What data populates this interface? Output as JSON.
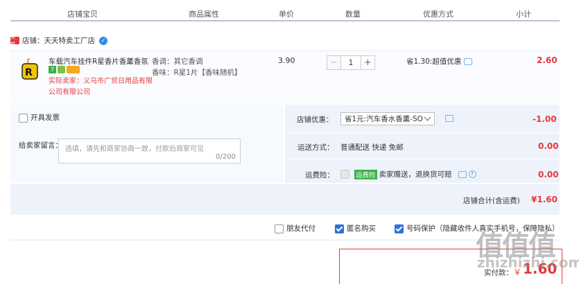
{
  "columns": [
    "店铺宝贝",
    "商品属性",
    "单价",
    "数量",
    "优惠方式",
    "小计"
  ],
  "shop": {
    "badge": "天猫",
    "name": "店铺：天天特卖工厂店"
  },
  "item": {
    "title": "车载汽车挂件R星香片香薰香氛...",
    "badge_num": "7",
    "seller": "实际卖家：义乌市广贸日用品有限公司有限公司",
    "attr1": "香调：其它香调",
    "attr2": "香味：R星1片【香味随机】",
    "price": "3.90",
    "qty": "1",
    "qty_minus": "−",
    "qty_plus": "+",
    "promo": "省1.30:超值优惠",
    "subtotal": "2.60"
  },
  "invoice_label": "开具发票",
  "message": {
    "label": "给卖家留言：",
    "placeholder": "选填，请先和商家协商一致，付款后商家可见",
    "count": "0/200"
  },
  "shop_discount": {
    "label": "店铺优惠：",
    "option": "省1元:汽车香水香薰-SO",
    "amount": "-1.00"
  },
  "shipping": {
    "label": "运送方式：",
    "value": "普通配送 快递 免邮",
    "amount": "0.00"
  },
  "insurance": {
    "label": "运费险：",
    "tag": "运费险",
    "value": "卖家赠送，退换货可赔",
    "amount": "0.00"
  },
  "shop_total": {
    "label": "店铺合计(含运费)",
    "amount": "¥1.60"
  },
  "options": {
    "friend_pay": "朋友代付",
    "anonymous": "匿名购买",
    "number_protect": "号码保护（隐藏收件人真实手机号，保障隐私）"
  },
  "pay": {
    "label": "实付款：",
    "currency": "￥",
    "amount": "1.60"
  },
  "watermark": {
    "brand": "值值值",
    "site": "zhizhizhi.com"
  },
  "colors": {
    "red": "#e4393c",
    "blue": "#2f6fd8",
    "header_line": "#b8c3d6"
  }
}
